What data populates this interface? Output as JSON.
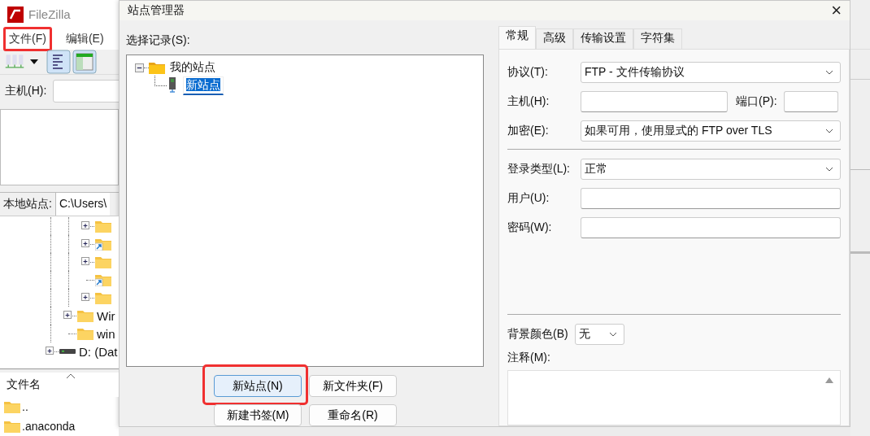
{
  "main_window": {
    "title": "FileZilla",
    "menu": [
      {
        "label": "文件(F)",
        "highlighted": true
      },
      {
        "label": "编辑(E)",
        "highlighted": false
      }
    ],
    "host_label": "主机(H):",
    "local_site_label": "本地站点:",
    "local_path": "C:\\Users\\",
    "local_tree": [
      {
        "kind": "above-view",
        "children": [
          {
            "kind": "above-view",
            "children": [
              {
                "kind": "folder",
                "expandable": true,
                "shortcut": false
              },
              {
                "kind": "folder",
                "expandable": true,
                "shortcut": true
              },
              {
                "kind": "folder",
                "expandable": true,
                "shortcut": false
              },
              {
                "kind": "folder",
                "expandable": false,
                "shortcut": true
              },
              {
                "kind": "folder",
                "expandable": true,
                "shortcut": false
              }
            ]
          },
          {
            "kind": "folder",
            "label": "Wir",
            "expandable": true,
            "shortcut": false
          },
          {
            "kind": "folder",
            "label": "win",
            "expandable": false,
            "shortcut": false
          }
        ]
      },
      {
        "kind": "drive",
        "label": "D: (Dat",
        "expandable": true
      }
    ],
    "file_list": {
      "column": "文件名",
      "rows": [
        {
          "name": ".."
        },
        {
          "name": ".anaconda"
        }
      ]
    }
  },
  "dialog": {
    "title": "站点管理器",
    "close": "×",
    "select_label": "选择记录(S):",
    "tree": [
      {
        "label": "我的站点",
        "kind": "folder",
        "expanded": true,
        "children": [
          {
            "label": "新站点",
            "kind": "site",
            "editing": true
          }
        ]
      }
    ],
    "buttons": [
      {
        "label": "新站点(N)",
        "highlighted": true
      },
      {
        "label": "新文件夹(F)",
        "highlighted": false
      },
      {
        "label": "新建书签(M)",
        "highlighted": false
      },
      {
        "label": "重命名(R)",
        "highlighted": false
      }
    ],
    "tabs": [
      {
        "label": "常规",
        "selected": true
      },
      {
        "label": "高级",
        "selected": false
      },
      {
        "label": "传输设置",
        "selected": false
      },
      {
        "label": "字符集",
        "selected": false
      }
    ],
    "protocol": {
      "label": "协议(T):",
      "value": "FTP - 文件传输协议"
    },
    "host": {
      "label": "主机(H):"
    },
    "port": {
      "label": "端口(P):"
    },
    "encryption": {
      "label": "加密(E):",
      "value": "如果可用，使用显式的 FTP over TLS"
    },
    "logon_type": {
      "label": "登录类型(L):",
      "value": "正常"
    },
    "user": {
      "label": "用户(U):"
    },
    "password": {
      "label": "密码(W):"
    },
    "background_color": {
      "label": "背景颜色(B)",
      "value": "无"
    },
    "comments": {
      "label": "注释(M):"
    }
  }
}
